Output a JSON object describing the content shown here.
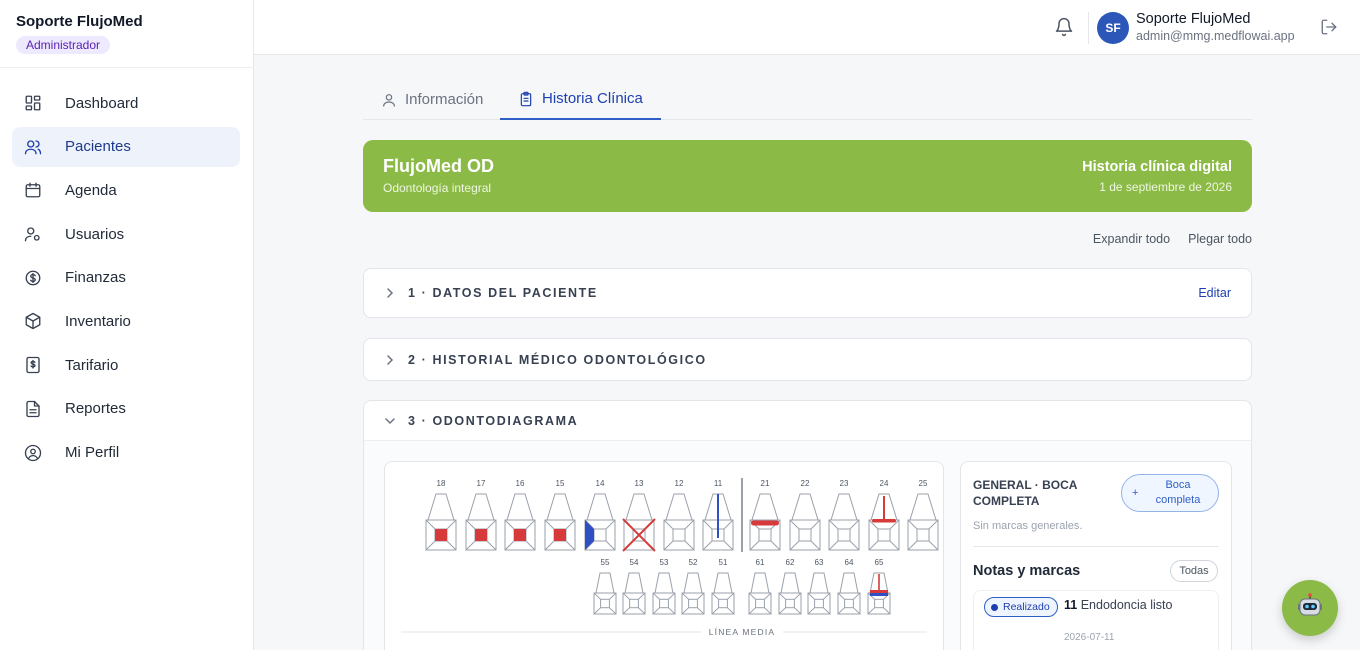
{
  "sidebar": {
    "brand_name": "Soporte FlujoMed",
    "role": "Administrador",
    "items": [
      {
        "label": "Dashboard",
        "icon": "dashboard-icon",
        "active": false
      },
      {
        "label": "Pacientes",
        "icon": "users-icon",
        "active": true
      },
      {
        "label": "Agenda",
        "icon": "calendar-icon",
        "active": false
      },
      {
        "label": "Usuarios",
        "icon": "user-gear-icon",
        "active": false
      },
      {
        "label": "Finanzas",
        "icon": "dollar-circle-icon",
        "active": false
      },
      {
        "label": "Inventario",
        "icon": "box-icon",
        "active": false
      },
      {
        "label": "Tarifario",
        "icon": "price-list-icon",
        "active": false
      },
      {
        "label": "Reportes",
        "icon": "document-icon",
        "active": false
      },
      {
        "label": "Mi Perfil",
        "icon": "profile-circle-icon",
        "active": false
      }
    ]
  },
  "topbar": {
    "avatar_initials": "SF",
    "user_name": "Soporte FlujoMed",
    "user_email": "admin@mmg.medflowai.app"
  },
  "tabs": [
    {
      "label": "Información",
      "active": false
    },
    {
      "label": "Historia Clínica",
      "active": true
    }
  ],
  "banner": {
    "title": "FlujoMed OD",
    "subtitle": "Odontología integral",
    "right_title": "Historia clínica digital",
    "right_date": "1 de septiembre de 2026",
    "color": "#8cba46"
  },
  "actions": {
    "expand_all": "Expandir todo",
    "collapse_all": "Plegar todo"
  },
  "sections": [
    {
      "title": "1 · DATOS DEL PACIENTE",
      "edit": "Editar",
      "expanded": false
    },
    {
      "title": "2 · HISTORIAL MÉDICO ODONTOLÓGICO",
      "expanded": false
    },
    {
      "title": "3 · ODONTODIAGRAMA",
      "expanded": true
    }
  ],
  "odontogram": {
    "upper_teeth": [
      {
        "num": "18",
        "mark": "caries"
      },
      {
        "num": "17",
        "mark": "caries"
      },
      {
        "num": "16",
        "mark": "caries"
      },
      {
        "num": "15",
        "mark": "caries"
      },
      {
        "num": "14",
        "mark": "restoration-left"
      },
      {
        "num": "13",
        "mark": "missing"
      },
      {
        "num": "12",
        "mark": "none"
      },
      {
        "num": "11",
        "mark": "endodontics-done"
      },
      {
        "num": "21",
        "mark": "crown"
      },
      {
        "num": "22",
        "mark": "none"
      },
      {
        "num": "23",
        "mark": "none"
      },
      {
        "num": "24",
        "mark": "endodontics-pending"
      },
      {
        "num": "25",
        "mark": "none"
      }
    ],
    "lower_teeth": [
      {
        "num": "55",
        "mark": "none"
      },
      {
        "num": "54",
        "mark": "none"
      },
      {
        "num": "53",
        "mark": "none"
      },
      {
        "num": "52",
        "mark": "none"
      },
      {
        "num": "51",
        "mark": "none"
      },
      {
        "num": "61",
        "mark": "none"
      },
      {
        "num": "62",
        "mark": "none"
      },
      {
        "num": "63",
        "mark": "none"
      },
      {
        "num": "64",
        "mark": "none"
      },
      {
        "num": "65",
        "mark": "endodontics-mixed"
      }
    ],
    "midline_label": "LÍNEA MEDIA",
    "colors": {
      "pending": "#d63a3a",
      "done": "#2f4fc4"
    }
  },
  "side_panel": {
    "title": "GENERAL · BOCA COMPLETA",
    "button": "Boca completa",
    "empty_text": "Sin marcas generales.",
    "notes_title": "Notas y marcas",
    "filter": "Todas",
    "note": {
      "status": "Realizado",
      "tooth": "11",
      "text": "Endodoncia listo",
      "date": "2026-07-11"
    }
  }
}
